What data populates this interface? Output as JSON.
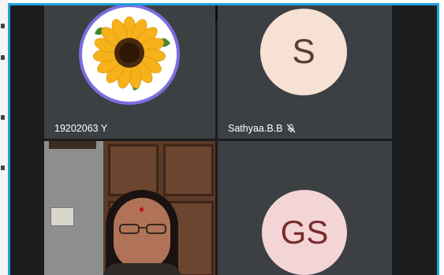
{
  "participants": [
    {
      "name": "19202063 Y",
      "avatar": "sunflower-image",
      "muted": false
    },
    {
      "name": "Sathyaa.B.B",
      "avatar_initials": "S",
      "muted": true,
      "mute_icon": "mic-off-icon"
    },
    {
      "name": "",
      "video": "webcam-feed",
      "muted": false
    },
    {
      "name": "",
      "avatar_initials": "GS",
      "muted": false
    }
  ],
  "colors": {
    "frame_border": "#1ea1d8",
    "tile_bg": "#3c4043",
    "avatar_s_bg": "#f6e1d4",
    "avatar_gs_bg": "#f4d5d6",
    "speaking_ring": "#7b6ee0"
  }
}
